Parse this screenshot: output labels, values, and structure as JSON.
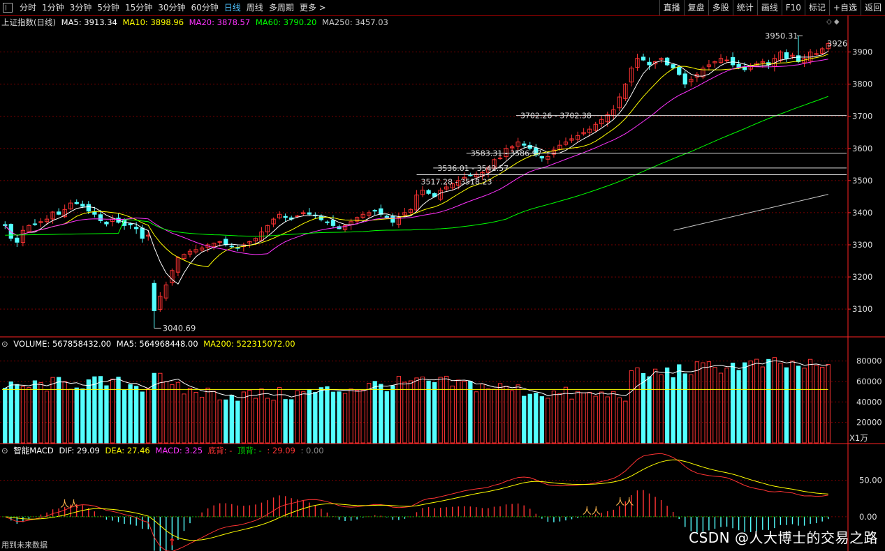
{
  "toolbar": {
    "periods": [
      "分时",
      "1分钟",
      "3分钟",
      "5分钟",
      "15分钟",
      "30分钟",
      "60分钟",
      "日线",
      "周线",
      "多周期",
      "更多 >"
    ],
    "active_index": 7,
    "right_buttons": [
      "直播",
      "复盘",
      "多股",
      "统计",
      "画线",
      "F10",
      "标记",
      "+自选",
      "返回"
    ]
  },
  "main_header": {
    "name": "上证指数(日线)",
    "ma5": "MA5: 3913.34",
    "ma10": "MA10: 3898.96",
    "ma20": "MA20: 3878.57",
    "ma60": "MA60: 3790.20",
    "ma250": "MA250: 3457.03"
  },
  "volume_header": {
    "name": "VOLUME: 567858432.00",
    "ma5": "MA5: 564968448.00",
    "ma200": "MA200: 522315072.00"
  },
  "macd_header": {
    "name": "智能MACD",
    "dif": "DIF: 29.09",
    "dea": "DEA: 27.46",
    "macd": "MACD: 3.25",
    "dibei": "底背: -",
    "dingbei": "顶背: -",
    "extra": ": 29.09",
    "extra2": ": 0.00"
  },
  "colors": {
    "up": "#ff3333",
    "down": "#54ffff",
    "ma5": "#ffffff",
    "ma10": "#ffff00",
    "ma20": "#ff33ff",
    "ma60": "#00ff00",
    "ma250": "#cccccc",
    "grid": "#7a0000",
    "axis": "#ff2222"
  },
  "chart_data": [
    {
      "type": "candlestick",
      "title": "上证指数(日线)",
      "y_ticks": [
        3100,
        3200,
        3300,
        3400,
        3500,
        3600,
        3700,
        3800,
        3900
      ],
      "ylim": [
        3020,
        3975
      ],
      "annotations": {
        "low": "3040.69",
        "high": "3950.31",
        "last": "3926",
        "gaps": [
          "3702.26 - 3702.38",
          "3583.31 - 3586.97",
          "3536.01 - 3542.57",
          "3517.28 - 3518.23"
        ]
      },
      "gap_levels": [
        3702.3,
        3585,
        3539,
        3518
      ],
      "closes": [
        3360,
        3320,
        3308,
        3345,
        3360,
        3365,
        3372,
        3380,
        3402,
        3395,
        3410,
        3430,
        3428,
        3420,
        3405,
        3395,
        3375,
        3365,
        3380,
        3370,
        3360,
        3362,
        3350,
        3320,
        3330,
        3095,
        3140,
        3175,
        3220,
        3260,
        3270,
        3280,
        3285,
        3290,
        3300,
        3305,
        3310,
        3300,
        3295,
        3290,
        3300,
        3310,
        3320,
        3340,
        3360,
        3380,
        3395,
        3385,
        3380,
        3390,
        3400,
        3395,
        3390,
        3378,
        3370,
        3360,
        3350,
        3360,
        3372,
        3385,
        3395,
        3400,
        3405,
        3395,
        3385,
        3370,
        3385,
        3400,
        3410,
        3455,
        3470,
        3460,
        3450,
        3470,
        3480,
        3490,
        3500,
        3510,
        3515,
        3520,
        3525,
        3540,
        3565,
        3570,
        3600,
        3605,
        3620,
        3610,
        3600,
        3580,
        3570,
        3575,
        3595,
        3610,
        3620,
        3630,
        3640,
        3650,
        3660,
        3675,
        3690,
        3705,
        3720,
        3760,
        3800,
        3850,
        3880,
        3875,
        3860,
        3870,
        3880,
        3860,
        3850,
        3830,
        3800,
        3815,
        3830,
        3850,
        3860,
        3870,
        3880,
        3875,
        3860,
        3850,
        3845,
        3855,
        3865,
        3870,
        3860,
        3880,
        3900,
        3880,
        3890,
        3870,
        3880,
        3900,
        3895,
        3910,
        3926
      ],
      "lows": [
        3310
      ],
      "ma250_start": 3345,
      "ma250_end": 3457.03,
      "legend": [
        "MA5",
        "MA10",
        "MA20",
        "MA60",
        "MA250"
      ]
    },
    {
      "type": "bar",
      "title": "VOLUME",
      "unit": "X1万",
      "y_ticks": [
        20000,
        40000,
        60000,
        80000
      ],
      "ylim": [
        0,
        92000
      ],
      "ma200": 52231
    },
    {
      "type": "line",
      "title": "智能MACD",
      "y_ticks": [
        "0.00",
        "50.00"
      ],
      "ylim": [
        -45,
        85
      ]
    }
  ],
  "watermark": "CSDN @人大博士的交易之路",
  "footnote": "用到未来数据"
}
